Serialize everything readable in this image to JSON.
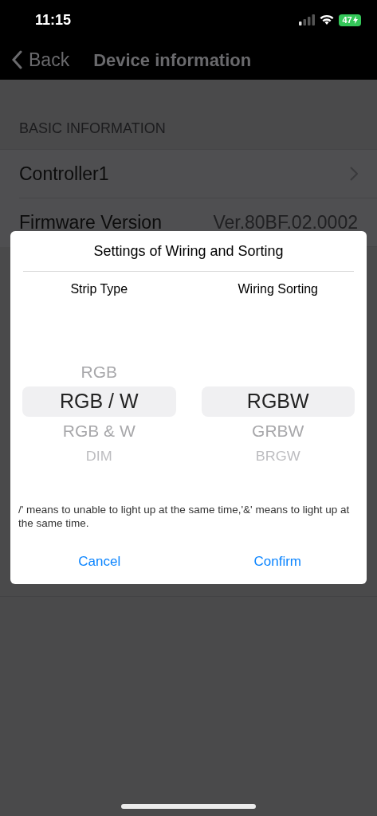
{
  "status_bar": {
    "time": "11:15",
    "battery": "47",
    "charging": true
  },
  "nav": {
    "back": "Back",
    "title": "Device information"
  },
  "section": {
    "header": "BASIC INFORMATION",
    "rows": [
      {
        "label": "Controller1",
        "value": "",
        "chevron": true
      },
      {
        "label": "Firmware Version",
        "value": "Ver.80BF.02.0002",
        "chevron": false
      }
    ]
  },
  "dialog": {
    "title": "Settings of Wiring and Sorting",
    "columns": [
      {
        "header": "Strip Type",
        "items": [
          {
            "label": "RGB",
            "selected": false
          },
          {
            "label": "RGB / W",
            "selected": true
          },
          {
            "label": "RGB & W",
            "selected": false
          },
          {
            "label": "DIM",
            "selected": false
          }
        ]
      },
      {
        "header": "Wiring Sorting",
        "items": [
          {
            "label": "RGBW",
            "selected": true
          },
          {
            "label": "GRBW",
            "selected": false
          },
          {
            "label": "BRGW",
            "selected": false
          }
        ]
      }
    ],
    "note": "/' means to unable to light up at the same time,'&' means to light up at the same time.",
    "buttons": [
      "Cancel",
      "Confirm"
    ]
  }
}
